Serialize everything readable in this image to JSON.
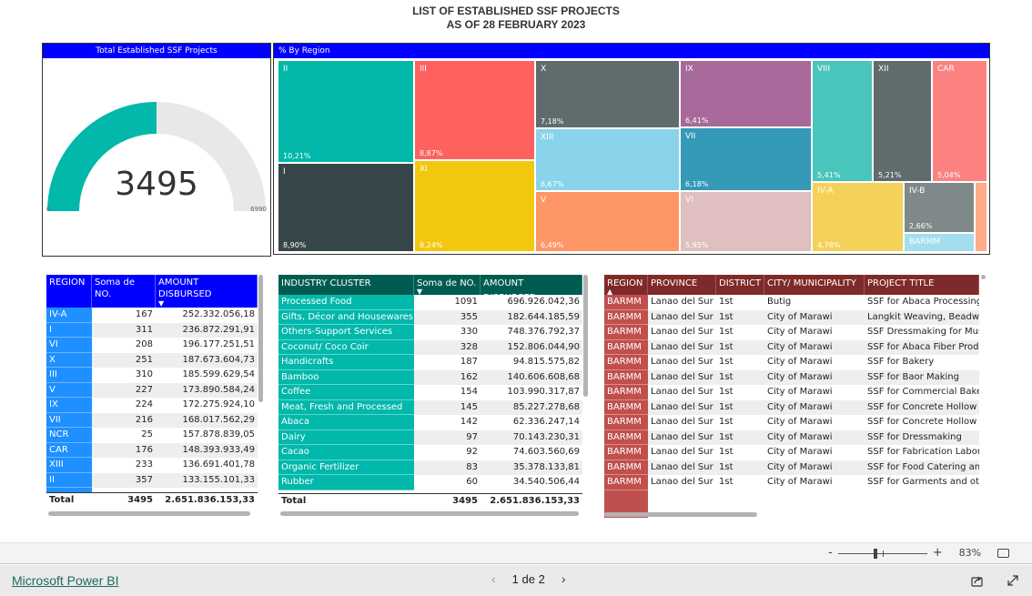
{
  "title": {
    "line1": "LIST OF ESTABLISHED SSF PROJECTS",
    "line2": "AS OF 28 FEBRUARY 2023"
  },
  "gauge": {
    "title": "Total Established SSF Projects",
    "value": 3495,
    "value_label": "3495",
    "min": 0,
    "max": 6990,
    "min_label": "0",
    "max_label": "6990",
    "fill_color": "#01b8aa",
    "bg_color": "#e8e8e8"
  },
  "treemap": {
    "title": "% By Region",
    "tiles": [
      {
        "label": "II",
        "pct": "10,21%",
        "value": 10.21,
        "color": "#01b8aa"
      },
      {
        "label": "I",
        "pct": "8,90%",
        "value": 8.9,
        "color": "#374649"
      },
      {
        "label": "III",
        "pct": "8,87%",
        "value": 8.87,
        "color": "#fd625e"
      },
      {
        "label": "XI",
        "pct": "8,24%",
        "value": 8.24,
        "color": "#f2c80f"
      },
      {
        "label": "X",
        "pct": "7,18%",
        "value": 7.18,
        "color": "#5f6b6d"
      },
      {
        "label": "XIII",
        "pct": "6,67%",
        "value": 6.67,
        "color": "#8ad4eb"
      },
      {
        "label": "V",
        "pct": "6,49%",
        "value": 6.49,
        "color": "#fe9666"
      },
      {
        "label": "IX",
        "pct": "6,41%",
        "value": 6.41,
        "color": "#a66999"
      },
      {
        "label": "VII",
        "pct": "6,18%",
        "value": 6.18,
        "color": "#3599b8"
      },
      {
        "label": "VI",
        "pct": "5,95%",
        "value": 5.95,
        "color": "#dfbfbf"
      },
      {
        "label": "VIII",
        "pct": "5,41%",
        "value": 5.41,
        "color": "#4ac5bb"
      },
      {
        "label": "XII",
        "pct": "5,21%",
        "value": 5.21,
        "color": "#5f6b6d"
      },
      {
        "label": "CAR",
        "pct": "5,04%",
        "value": 5.04,
        "color": "#fb8281"
      },
      {
        "label": "IV-A",
        "pct": "4,78%",
        "value": 4.78,
        "color": "#f4d25a"
      },
      {
        "label": "IV-B",
        "pct": "2,66%",
        "value": 2.66,
        "color": "#7f898a"
      },
      {
        "label": "BARMM",
        "pct": "",
        "value": null,
        "color": "#a4ddee"
      },
      {
        "label": "",
        "pct": "",
        "value": null,
        "color": "#fdab89"
      }
    ]
  },
  "region_table": {
    "headers": [
      "REGION",
      "Soma de NO.",
      "AMOUNT DISBURSED"
    ],
    "header_color": "#0000ff",
    "rows": [
      [
        "IV-A",
        "167",
        "252.332.056,18"
      ],
      [
        "I",
        "311",
        "236.872.291,91"
      ],
      [
        "VI",
        "208",
        "196.177.251,51"
      ],
      [
        "X",
        "251",
        "187.673.604,73"
      ],
      [
        "III",
        "310",
        "185.599.629,54"
      ],
      [
        "V",
        "227",
        "173.890.584,24"
      ],
      [
        "IX",
        "224",
        "172.275.924,10"
      ],
      [
        "VII",
        "216",
        "168.017.562,29"
      ],
      [
        "NCR",
        "25",
        "157.878.839,05"
      ],
      [
        "CAR",
        "176",
        "148.393.933,49"
      ],
      [
        "XIII",
        "233",
        "136.691.401,78"
      ],
      [
        "II",
        "357",
        "133.155.101,33"
      ]
    ],
    "total": [
      "Total",
      "3495",
      "2.651.836.153,33"
    ]
  },
  "industry_table": {
    "headers": [
      "INDUSTRY CLUSTER",
      "Soma de NO.",
      "AMOUNT DISBURSED"
    ],
    "header_color": "#005c50",
    "rows": [
      [
        "Processed Food",
        "1091",
        "696.926.042,36"
      ],
      [
        "Gifts, Décor and Housewares",
        "355",
        "182.644.185,59"
      ],
      [
        "Others-Support Services",
        "330",
        "748.376.792,37"
      ],
      [
        "Coconut/ Coco Coir",
        "328",
        "152.806.044,90"
      ],
      [
        "Handicrafts",
        "187",
        "94.815.575,82"
      ],
      [
        "Bamboo",
        "162",
        "140.606.608,68"
      ],
      [
        "Coffee",
        "154",
        "103.990.317,87"
      ],
      [
        "Meat, Fresh and Processed",
        "145",
        "85.227.278,68"
      ],
      [
        "Abaca",
        "142",
        "62.336.247,14"
      ],
      [
        "Dairy",
        "97",
        "70.143.230,31"
      ],
      [
        "Cacao",
        "92",
        "74.603.560,69"
      ],
      [
        "Organic Fertilizer",
        "83",
        "35.378.133,81"
      ],
      [
        "Rubber",
        "60",
        "34.540.506,44"
      ]
    ],
    "total": [
      "Total",
      "3495",
      "2.651.836.153,33"
    ]
  },
  "project_table": {
    "headers": [
      "REGION",
      "PROVINCE",
      "DISTRICT",
      "CITY/ MUNICIPALITY",
      "PROJECT TITLE"
    ],
    "header_color": "#7f2a2a",
    "rows": [
      [
        "BARMM",
        "Lanao del Sur",
        "1st",
        "Butig",
        "SSF for Abaca Processing"
      ],
      [
        "BARMM",
        "Lanao del Sur",
        "1st",
        "City of Marawi",
        "Langkit Weaving, Beadwo"
      ],
      [
        "BARMM",
        "Lanao del Sur",
        "1st",
        "City of Marawi",
        "SSF Dressmaking for Mus"
      ],
      [
        "BARMM",
        "Lanao del Sur",
        "1st",
        "City of Marawi",
        "SSF for Abaca Fiber Produ"
      ],
      [
        "BARMM",
        "Lanao del Sur",
        "1st",
        "City of Marawi",
        "SSF for Bakery"
      ],
      [
        "BARMM",
        "Lanao del Sur",
        "1st",
        "City of Marawi",
        "SSF for Baor Making"
      ],
      [
        "BARMM",
        "Lanao del Sur",
        "1st",
        "City of Marawi",
        "SSF for Commercial Baker"
      ],
      [
        "BARMM",
        "Lanao del Sur",
        "1st",
        "City of Marawi",
        "SSF for Concrete Hollow B"
      ],
      [
        "BARMM",
        "Lanao del Sur",
        "1st",
        "City of Marawi",
        "SSF for Concrete Hollow B"
      ],
      [
        "BARMM",
        "Lanao del Sur",
        "1st",
        "City of Marawi",
        "SSF for Dressmaking"
      ],
      [
        "BARMM",
        "Lanao del Sur",
        "1st",
        "City of Marawi",
        "SSF for Fabrication Labora"
      ],
      [
        "BARMM",
        "Lanao del Sur",
        "1st",
        "City of Marawi",
        "SSF for Food Catering and"
      ],
      [
        "BARMM",
        "Lanao del Sur",
        "1st",
        "City of Marawi",
        "SSF for Garments and oth"
      ]
    ]
  },
  "zoom": {
    "minus": "-",
    "plus": "+",
    "level": "83%",
    "level_pct": 83
  },
  "footer": {
    "brand_link": "Microsoft Power BI",
    "page_indicator": "1 de 2",
    "prev": "‹",
    "next": "›",
    "share_icon": "share-icon",
    "fullscreen_icon": "expand-icon"
  }
}
